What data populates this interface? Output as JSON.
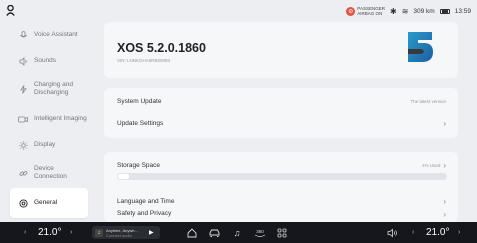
{
  "status": {
    "airbag_line1": "PASSENGER",
    "airbag_line2": "AIRBAG ON",
    "range": "309 km",
    "time": "13:59"
  },
  "sidebar": {
    "items": [
      {
        "label": "Voice Assistant",
        "icon": "voice-assistant-icon"
      },
      {
        "label": "Sounds",
        "icon": "speaker-icon"
      },
      {
        "label": "Charging and Discharging",
        "icon": "charging-icon"
      },
      {
        "label": "Intelligent Imaging",
        "icon": "camera-icon"
      },
      {
        "label": "Display",
        "icon": "brightness-icon"
      },
      {
        "label": "Device Connection",
        "icon": "link-icon"
      },
      {
        "label": "General",
        "icon": "gear-icon"
      }
    ]
  },
  "header": {
    "version": "XOS 5.2.0.1860",
    "vin": "VIN: LNNKGHA9RB00083"
  },
  "updates": {
    "system_update_label": "System Update",
    "system_update_status": "The latest version",
    "update_settings_label": "Update Settings"
  },
  "storage": {
    "label": "Storage Space",
    "used_text": "4% Used",
    "used_fraction": 0.04
  },
  "general_rows": {
    "language_time": "Language and Time",
    "safety_privacy": "Safety and Privacy"
  },
  "bottom": {
    "left_temp": "21.0°",
    "right_temp": "21.0°",
    "media_title": "Anytime, Anywh...",
    "media_sub": "Connect audio"
  }
}
